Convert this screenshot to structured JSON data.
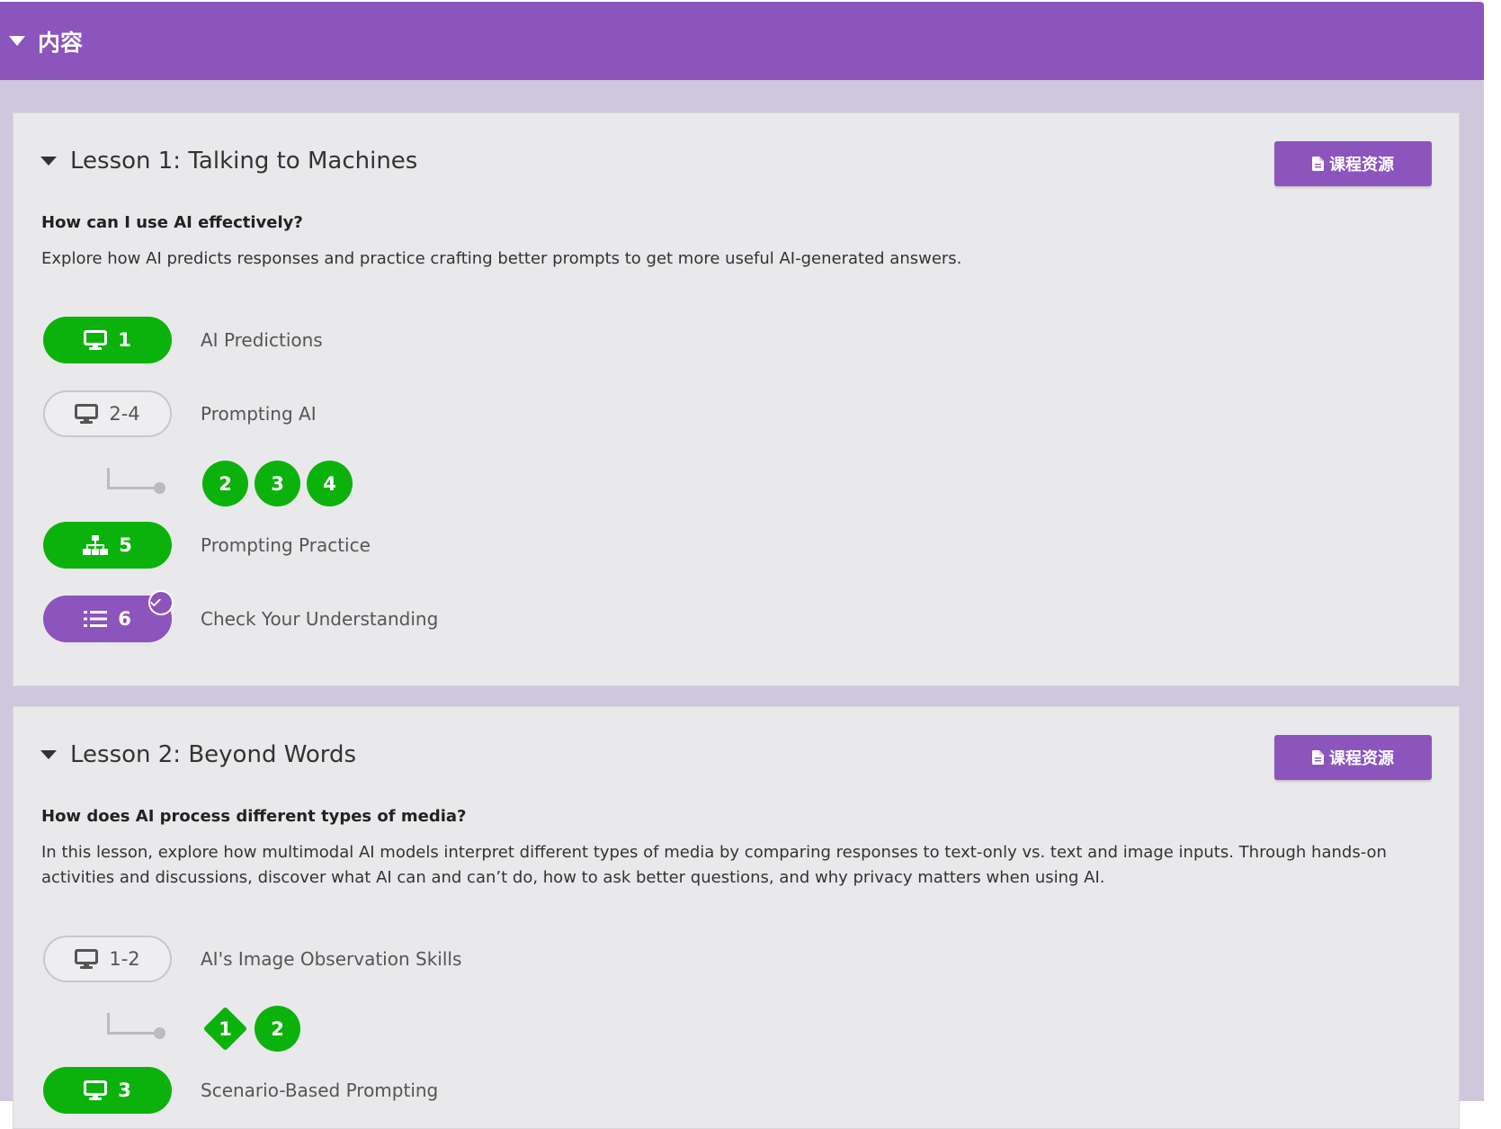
{
  "header": {
    "title": "内容"
  },
  "lessons": [
    {
      "title": "Lesson 1: Talking to Machines",
      "resources_label": "课程资源",
      "question": "How can I use AI effectively?",
      "description": "Explore how AI predicts responses and practice crafting better prompts to get more useful AI-generated answers.",
      "activities": [
        {
          "badge": "1",
          "label": "AI Predictions",
          "icon": "monitor-icon",
          "style": "completed"
        },
        {
          "badge": "2-4",
          "label": "Prompting AI",
          "icon": "monitor-icon",
          "style": "outline",
          "sublevels": [
            "2",
            "3",
            "4"
          ]
        },
        {
          "badge": "5",
          "label": "Prompting Practice",
          "icon": "sitemap-icon",
          "style": "completed"
        },
        {
          "badge": "6",
          "label": "Check Your Understanding",
          "icon": "list-icon",
          "style": "assessment-submitted"
        }
      ]
    },
    {
      "title": "Lesson 2: Beyond Words",
      "resources_label": "课程资源",
      "question": "How does AI process different types of media?",
      "description": "In this lesson, explore how multimodal AI models interpret different types of media by comparing responses to text-only vs. text and image inputs. Through hands-on activities and discussions, discover what AI can and can’t do, how to ask better questions, and why privacy matters when using AI.",
      "activities": [
        {
          "badge": "1-2",
          "label": "AI's Image Observation Skills",
          "icon": "monitor-icon",
          "style": "outline",
          "sublevels": [
            "1",
            "2"
          ]
        },
        {
          "badge": "3",
          "label": "Scenario-Based Prompting",
          "icon": "monitor-icon",
          "style": "completed"
        }
      ]
    }
  ],
  "colors": {
    "brand": "#8c54bd",
    "completed": "#0cb20c",
    "page_bg": "#cfc8dd",
    "card_bg": "#e9e9eb"
  }
}
